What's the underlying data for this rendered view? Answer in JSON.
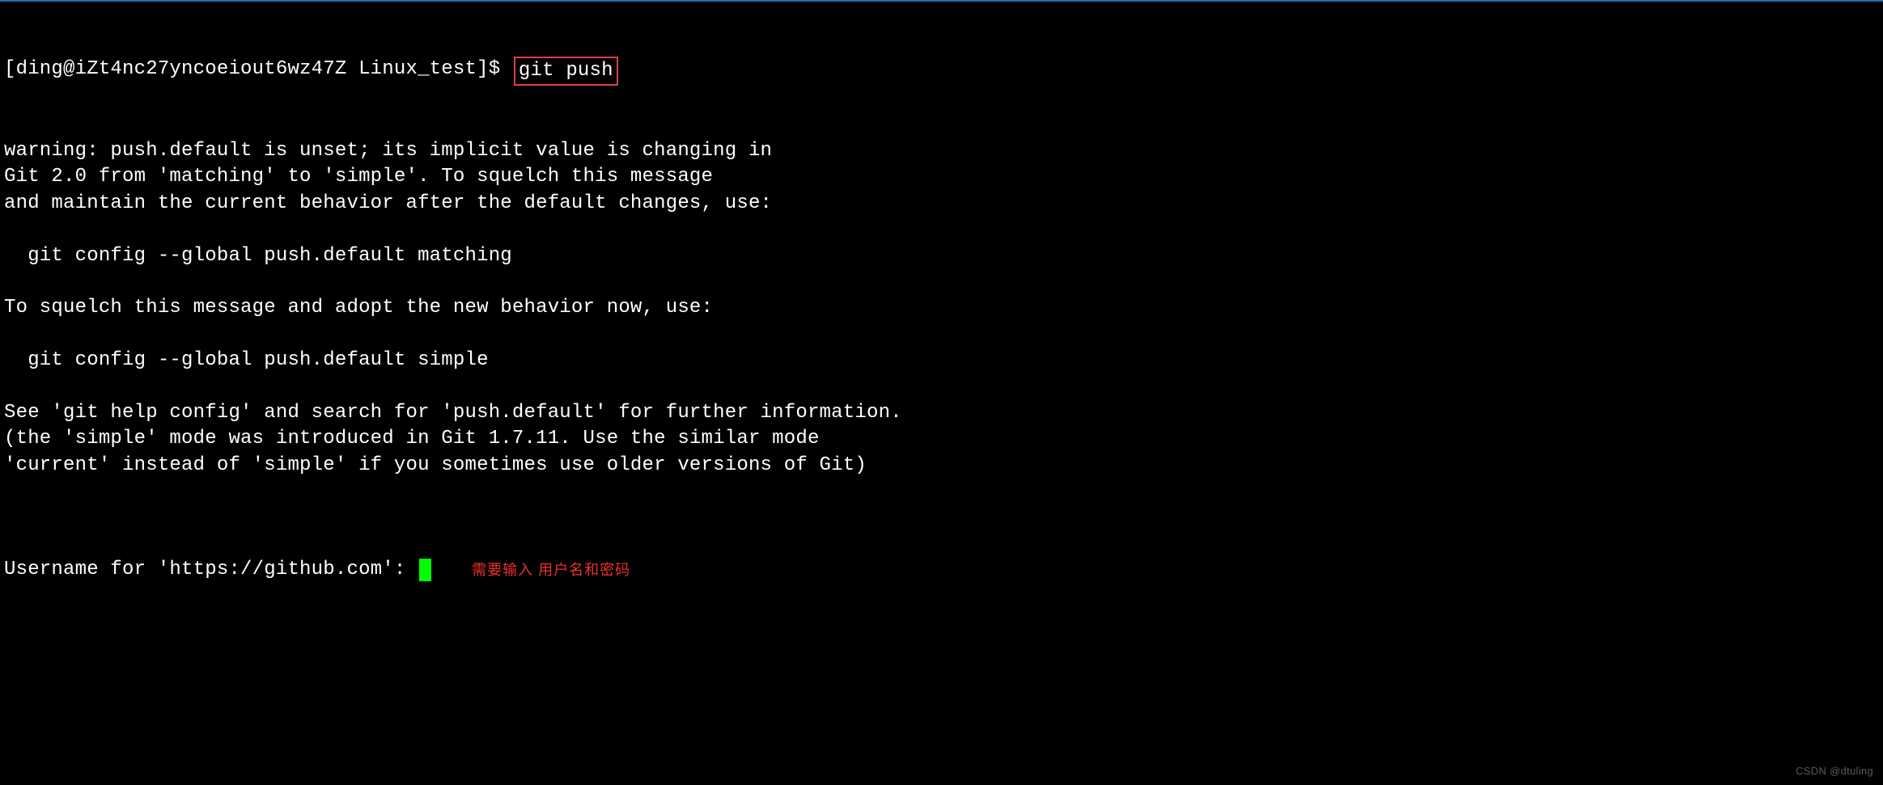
{
  "terminal": {
    "prompt": "[ding@iZt4nc27yncoeiout6wz47Z Linux_test]$ ",
    "command": "git push",
    "output": [
      "warning: push.default is unset; its implicit value is changing in",
      "Git 2.0 from 'matching' to 'simple'. To squelch this message",
      "and maintain the current behavior after the default changes, use:",
      "",
      "  git config --global push.default matching",
      "",
      "To squelch this message and adopt the new behavior now, use:",
      "",
      "  git config --global push.default simple",
      "",
      "See 'git help config' and search for 'push.default' for further information.",
      "(the 'simple' mode was introduced in Git 1.7.11. Use the similar mode",
      "'current' instead of 'simple' if you sometimes use older versions of Git)",
      ""
    ],
    "input_prompt": "Username for 'https://github.com': ",
    "annotation": "需要输入 用户名和密码"
  },
  "watermark": "CSDN @dtuling"
}
